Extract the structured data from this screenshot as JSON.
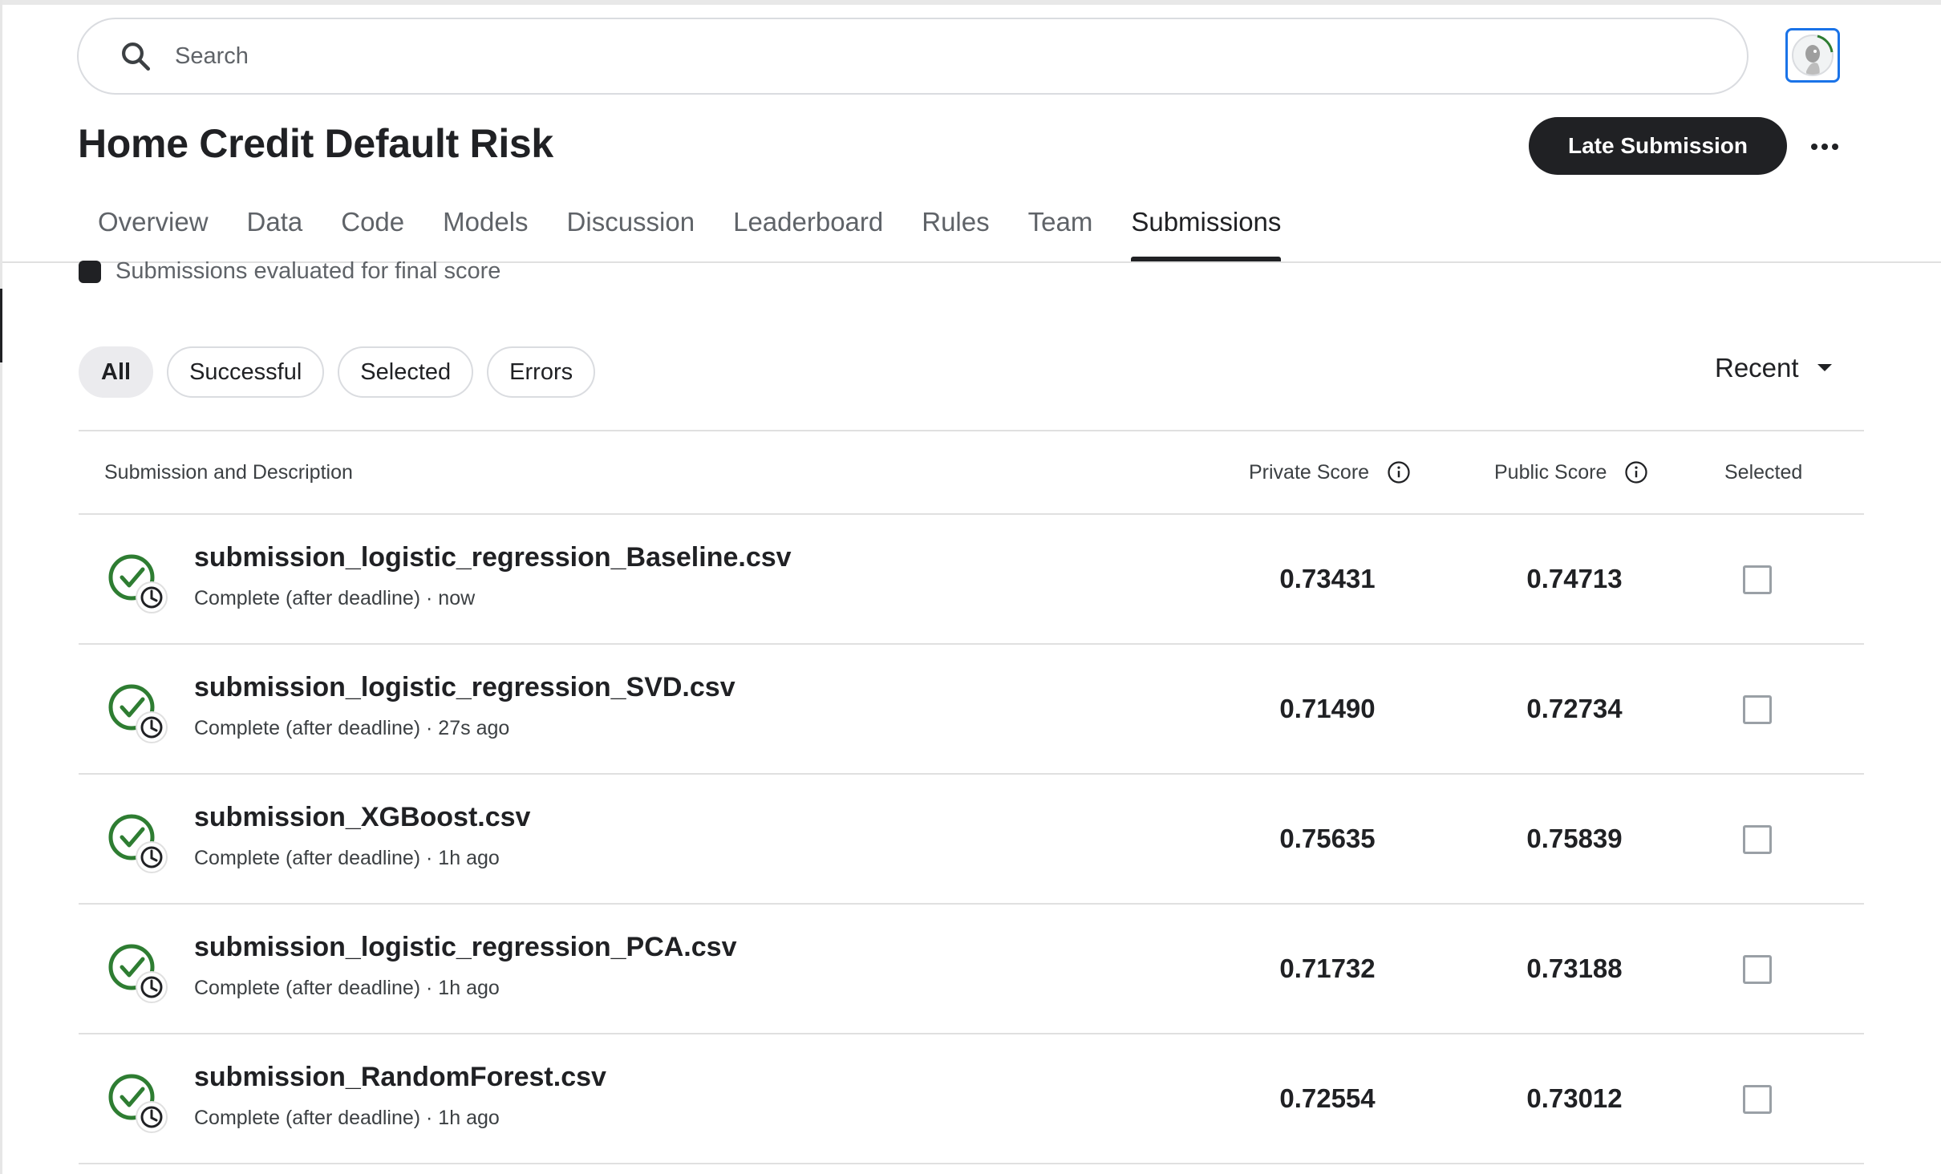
{
  "search": {
    "placeholder": "Search"
  },
  "competition": {
    "title": "Home Credit Default Risk"
  },
  "actions": {
    "late_submission_label": "Late Submission"
  },
  "tabs": [
    {
      "label": "Overview"
    },
    {
      "label": "Data"
    },
    {
      "label": "Code"
    },
    {
      "label": "Models"
    },
    {
      "label": "Discussion"
    },
    {
      "label": "Leaderboard"
    },
    {
      "label": "Rules"
    },
    {
      "label": "Team"
    },
    {
      "label": "Submissions",
      "active": true
    }
  ],
  "legend": {
    "text": "Submissions evaluated for final score"
  },
  "filters": [
    {
      "label": "All",
      "active": true
    },
    {
      "label": "Successful"
    },
    {
      "label": "Selected"
    },
    {
      "label": "Errors"
    }
  ],
  "sort": {
    "label": "Recent"
  },
  "table": {
    "headers": {
      "submission": "Submission and Description",
      "private_score": "Private Score",
      "public_score": "Public Score",
      "selected": "Selected"
    },
    "rows": [
      {
        "file": "submission_logistic_regression_Baseline.csv",
        "meta": "Complete (after deadline) · now",
        "private": "0.73431",
        "public": "0.74713",
        "selected": false
      },
      {
        "file": "submission_logistic_regression_SVD.csv",
        "meta": "Complete (after deadline) · 27s ago",
        "private": "0.71490",
        "public": "0.72734",
        "selected": false
      },
      {
        "file": "submission_XGBoost.csv",
        "meta": "Complete (after deadline) · 1h ago",
        "private": "0.75635",
        "public": "0.75839",
        "selected": false
      },
      {
        "file": "submission_logistic_regression_PCA.csv",
        "meta": "Complete (after deadline) · 1h ago",
        "private": "0.71732",
        "public": "0.73188",
        "selected": false
      },
      {
        "file": "submission_RandomForest.csv",
        "meta": "Complete (after deadline) · 1h ago",
        "private": "0.72554",
        "public": "0.73012",
        "selected": false
      }
    ]
  },
  "colors": {
    "success_green": "#2e7d32",
    "text_primary": "#202124",
    "button_dark": "#202124"
  }
}
